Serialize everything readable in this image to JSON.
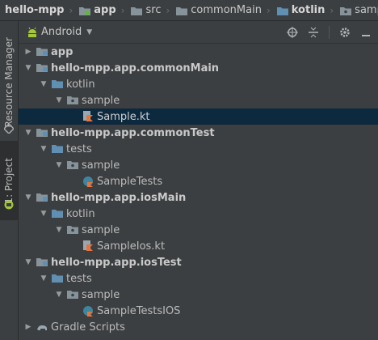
{
  "breadcrumb": {
    "items": [
      {
        "label": "hello-mpp",
        "bold": true,
        "icon": "project-icon"
      },
      {
        "label": "app",
        "bold": true,
        "icon": "module-folder-icon"
      },
      {
        "label": "src",
        "bold": false,
        "icon": "folder-icon"
      },
      {
        "label": "commonMain",
        "bold": false,
        "icon": "folder-icon"
      },
      {
        "label": "kotlin",
        "bold": true,
        "icon": "source-folder-icon"
      },
      {
        "label": "sample",
        "bold": false,
        "icon": "package-icon"
      }
    ]
  },
  "sidebar": {
    "tabs": [
      {
        "label": "Resource Manager",
        "icon": "resource-manager-icon"
      },
      {
        "label": "1: Project",
        "icon": "android-project-icon"
      }
    ]
  },
  "toolbar": {
    "view_selected": "Android",
    "icons": [
      "locate-icon",
      "collapse-all-icon",
      "settings-icon",
      "hide-icon"
    ]
  },
  "tree": [
    {
      "label": "app",
      "depth": 0,
      "expanded": false,
      "bold": true,
      "icon": "module-folder-icon"
    },
    {
      "label": "hello-mpp.app.commonMain",
      "depth": 0,
      "expanded": true,
      "bold": true,
      "icon": "module-folder-icon"
    },
    {
      "label": "kotlin",
      "depth": 1,
      "expanded": true,
      "bold": false,
      "icon": "source-folder-icon"
    },
    {
      "label": "sample",
      "depth": 2,
      "expanded": true,
      "bold": false,
      "icon": "package-icon"
    },
    {
      "label": "Sample.kt",
      "depth": 3,
      "leaf": true,
      "bold": false,
      "selected": true,
      "icon": "kotlin-file-icon"
    },
    {
      "label": "hello-mpp.app.commonTest",
      "depth": 0,
      "expanded": true,
      "bold": true,
      "icon": "module-folder-icon"
    },
    {
      "label": "tests",
      "depth": 1,
      "expanded": true,
      "bold": false,
      "icon": "test-folder-icon"
    },
    {
      "label": "sample",
      "depth": 2,
      "expanded": true,
      "bold": false,
      "icon": "package-icon"
    },
    {
      "label": "SampleTests",
      "depth": 3,
      "leaf": true,
      "bold": false,
      "icon": "kotlin-class-icon"
    },
    {
      "label": "hello-mpp.app.iosMain",
      "depth": 0,
      "expanded": true,
      "bold": true,
      "icon": "module-folder-icon"
    },
    {
      "label": "kotlin",
      "depth": 1,
      "expanded": true,
      "bold": false,
      "icon": "source-folder-icon"
    },
    {
      "label": "sample",
      "depth": 2,
      "expanded": true,
      "bold": false,
      "icon": "package-icon"
    },
    {
      "label": "SampleIos.kt",
      "depth": 3,
      "leaf": true,
      "bold": false,
      "icon": "kotlin-file-icon"
    },
    {
      "label": "hello-mpp.app.iosTest",
      "depth": 0,
      "expanded": true,
      "bold": true,
      "icon": "module-folder-icon"
    },
    {
      "label": "tests",
      "depth": 1,
      "expanded": true,
      "bold": false,
      "icon": "test-folder-icon"
    },
    {
      "label": "sample",
      "depth": 2,
      "expanded": true,
      "bold": false,
      "icon": "package-icon"
    },
    {
      "label": "SampleTestsIOS",
      "depth": 3,
      "leaf": true,
      "bold": false,
      "icon": "kotlin-class-icon"
    },
    {
      "label": "Gradle Scripts",
      "depth": 0,
      "expanded": false,
      "bold": false,
      "icon": "gradle-icon"
    }
  ],
  "colors": {
    "background": "#3c3f41",
    "selection": "#0d293e",
    "folder_blue": "#5f8fb3",
    "module_dot": "#62b543",
    "kotlin_orange": "#e8743b",
    "android_green": "#a4c639"
  }
}
